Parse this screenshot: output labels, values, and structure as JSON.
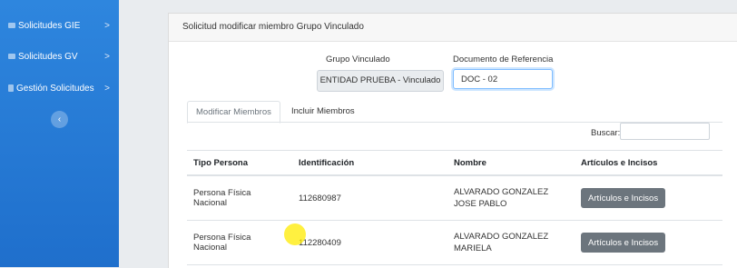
{
  "sidebar": {
    "items": [
      {
        "label": "Solicitudes GIE",
        "icon": "folder-icon",
        "chevron": ">"
      },
      {
        "label": "Solicitudes GV",
        "icon": "folder-icon",
        "chevron": ">"
      },
      {
        "label": "Gestión Solicitudes",
        "icon": "document-icon",
        "chevron": ">"
      }
    ],
    "collapse_glyph": "‹"
  },
  "card": {
    "title": "Solicitud modificar miembro Grupo Vinculado",
    "grupo_label": "Grupo Vinculado",
    "grupo_value": "ENTIDAD PRUEBA - Vinculado",
    "doc_label": "Documento de Referencia",
    "doc_value": "DOC - 02",
    "tabs": [
      {
        "label": "Modificar Miembros",
        "active": true
      },
      {
        "label": "Incluir Miembros",
        "active": false
      }
    ],
    "search_label": "Buscar:"
  },
  "table": {
    "headers": [
      "Tipo Persona",
      "Identificación",
      "Nombre",
      "Artículos e Incisos"
    ],
    "rows": [
      {
        "tipo": "Persona Física Nacional",
        "id": "112680987",
        "nombre": "ALVARADO GONZALEZ JOSE PABLO",
        "button": "Artículos e Incisos"
      },
      {
        "tipo": "Persona Física Nacional",
        "id": "112280409",
        "nombre": "ALVARADO GONZALEZ MARIELA",
        "button": "Artículos e Incisos"
      }
    ]
  },
  "colors": {
    "sidebar": "#1f6fcc",
    "button": "#6c757d",
    "cursor_highlight": "#ffeb00"
  }
}
